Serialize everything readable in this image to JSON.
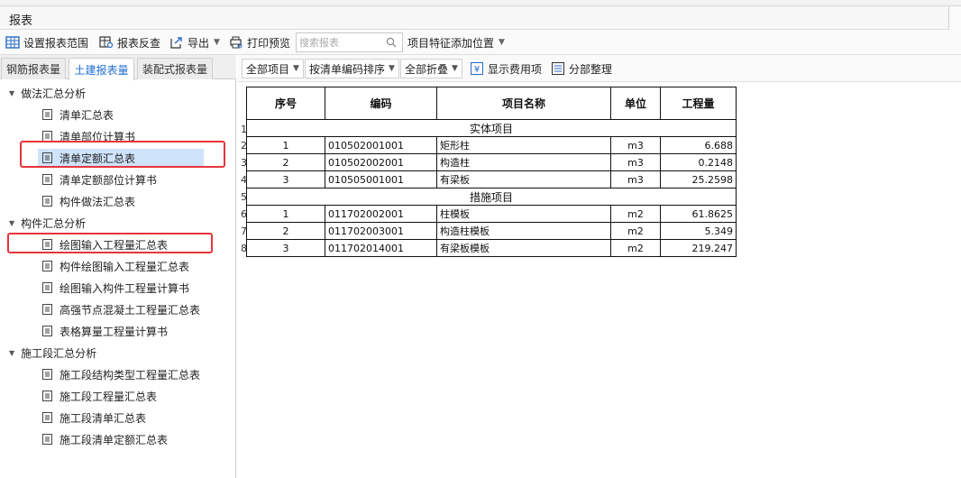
{
  "window": {
    "title": "报表"
  },
  "toolbar": {
    "set_range": "设置报表范围",
    "reverse_check": "报表反查",
    "export": "导出",
    "print_preview": "打印预览",
    "search_placeholder": "搜索报表",
    "add_feature_position": "项目特征添加位置"
  },
  "tabs": [
    {
      "label": "钢筋报表量"
    },
    {
      "label": "土建报表量"
    },
    {
      "label": "装配式报表量"
    }
  ],
  "tree": {
    "groups": [
      {
        "label": "做法汇总分析",
        "items": [
          "清单汇总表",
          "清单部位计算书",
          "清单定额汇总表",
          "清单定额部位计算书",
          "构件做法汇总表"
        ]
      },
      {
        "label": "构件汇总分析",
        "items": [
          "绘图输入工程量汇总表",
          "构件绘图输入工程量汇总表",
          "绘图输入构件工程量计算书",
          "高强节点混凝土工程量汇总表",
          "表格算量工程量计算书"
        ]
      },
      {
        "label": "施工段汇总分析",
        "items": [
          "施工段结构类型工程量汇总表",
          "施工段工程量汇总表",
          "施工段清单汇总表",
          "施工段清单定额汇总表"
        ]
      }
    ]
  },
  "report_toolbar": {
    "filter_items": "全部项目",
    "sort_order": "按清单编码排序",
    "fold": "全部折叠",
    "show_fee_items": "显示费用项",
    "arrange_parts": "分部整理"
  },
  "report": {
    "headers": [
      "序号",
      "编码",
      "项目名称",
      "单位",
      "工程量"
    ],
    "sections": [
      {
        "title": "实体项目",
        "rows": [
          [
            "1",
            "010502001001",
            "矩形柱",
            "m3",
            "6.688"
          ],
          [
            "2",
            "010502002001",
            "构造柱",
            "m3",
            "0.2148"
          ],
          [
            "3",
            "010505001001",
            "有梁板",
            "m3",
            "25.2598"
          ]
        ]
      },
      {
        "title": "措施项目",
        "rows": [
          [
            "1",
            "011702002001",
            "柱模板",
            "m2",
            "61.8625"
          ],
          [
            "2",
            "011702003001",
            "构造柱模板",
            "m2",
            "5.349"
          ],
          [
            "3",
            "011702014001",
            "有梁板模板",
            "m2",
            "219.247"
          ]
        ]
      }
    ],
    "row_numbers": [
      "1",
      "2",
      "3",
      "4",
      "5",
      "6",
      "7",
      "8"
    ]
  }
}
